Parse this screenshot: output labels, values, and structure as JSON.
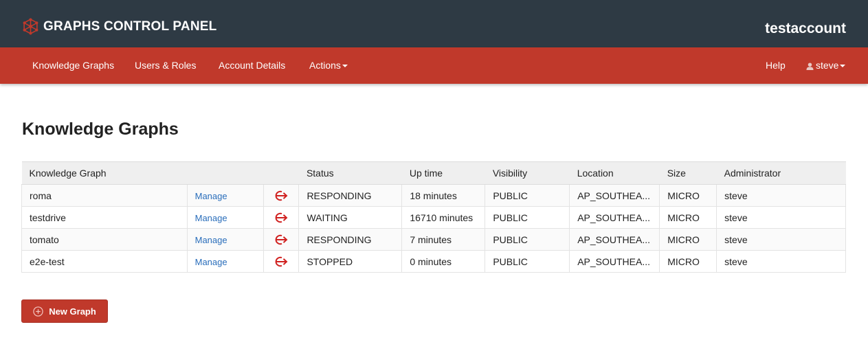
{
  "header": {
    "brand": "GRAPHS CONTROL PANEL",
    "account": "testaccount"
  },
  "nav": {
    "knowledge_graphs": "Knowledge Graphs",
    "users_roles": "Users & Roles",
    "account_details": "Account Details",
    "actions": "Actions",
    "help": "Help",
    "user": "steve"
  },
  "page": {
    "title": "Knowledge Graphs",
    "new_graph_button": "New Graph"
  },
  "table": {
    "headers": [
      "Knowledge Graph",
      "",
      "",
      "Status",
      "Up time",
      "Visibility",
      "Location",
      "Size",
      "Administrator"
    ],
    "rows": [
      {
        "name": "roma",
        "manage": "Manage",
        "status": "RESPONDING",
        "uptime": "18 minutes",
        "visibility": "PUBLIC",
        "location": "AP_SOUTHEA...",
        "size": "MICRO",
        "admin": "steve"
      },
      {
        "name": "testdrive",
        "manage": "Manage",
        "status": "WAITING",
        "uptime": "16710 minutes",
        "visibility": "PUBLIC",
        "location": "AP_SOUTHEA...",
        "size": "MICRO",
        "admin": "steve"
      },
      {
        "name": "tomato",
        "manage": "Manage",
        "status": "RESPONDING",
        "uptime": "7 minutes",
        "visibility": "PUBLIC",
        "location": "AP_SOUTHEA...",
        "size": "MICRO",
        "admin": "steve"
      },
      {
        "name": "e2e-test",
        "manage": "Manage",
        "status": "STOPPED",
        "uptime": "0 minutes",
        "visibility": "PUBLIC",
        "location": "AP_SOUTHEA...",
        "size": "MICRO",
        "admin": "steve"
      }
    ]
  },
  "icons": {
    "brand": "graph-network-icon",
    "user": "user-icon",
    "row_action": "sign-in-arrow-icon",
    "new_graph": "plus-circle-icon"
  },
  "colors": {
    "topbar": "#2e3a44",
    "navbar": "#c0392b",
    "link": "#2a6ebb",
    "icon_red": "#d0201f"
  }
}
